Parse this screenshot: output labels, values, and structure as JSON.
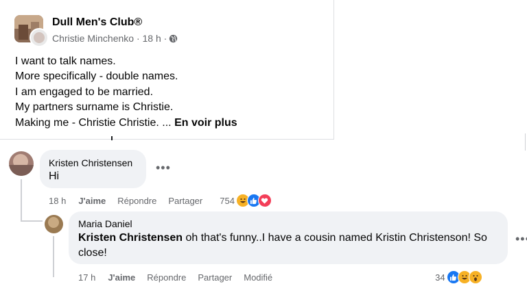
{
  "post": {
    "group_name": "Dull Men's Club®",
    "author_line": "Christie Minchenko · 18 h ·",
    "lines": [
      "I want to talk names.",
      "More specifically - double names.",
      "I am engaged to be married.",
      "My partners surname is Christie.",
      "Making me - Christie Christie. ..."
    ],
    "see_more": "En voir plus"
  },
  "comments": [
    {
      "author": "Kristen Christensen",
      "text": "Hi",
      "time": "18 h",
      "like": "J'aime",
      "reply": "Répondre",
      "share": "Partager",
      "reaction_count": "754",
      "reactions": [
        "haha-icon",
        "like-icon",
        "love-icon"
      ]
    },
    {
      "author": "Maria Daniel",
      "mention": "Kristen Christensen",
      "text": " oh that's funny..I have a cousin named Kristin Christenson! So close!",
      "time": "17 h",
      "like": "J'aime",
      "reply": "Répondre",
      "share": "Partager",
      "edited": "Modifié",
      "reaction_count": "34",
      "reactions": [
        "like-icon",
        "haha-icon",
        "wow-icon"
      ]
    }
  ],
  "colors": {
    "like_blue": "#1877f2",
    "love_red": "#f33e58",
    "emoji_yellow": "#f7b125",
    "secondary_text": "#65676b",
    "bubble_bg": "#f0f2f5"
  },
  "more_icon": "•••"
}
